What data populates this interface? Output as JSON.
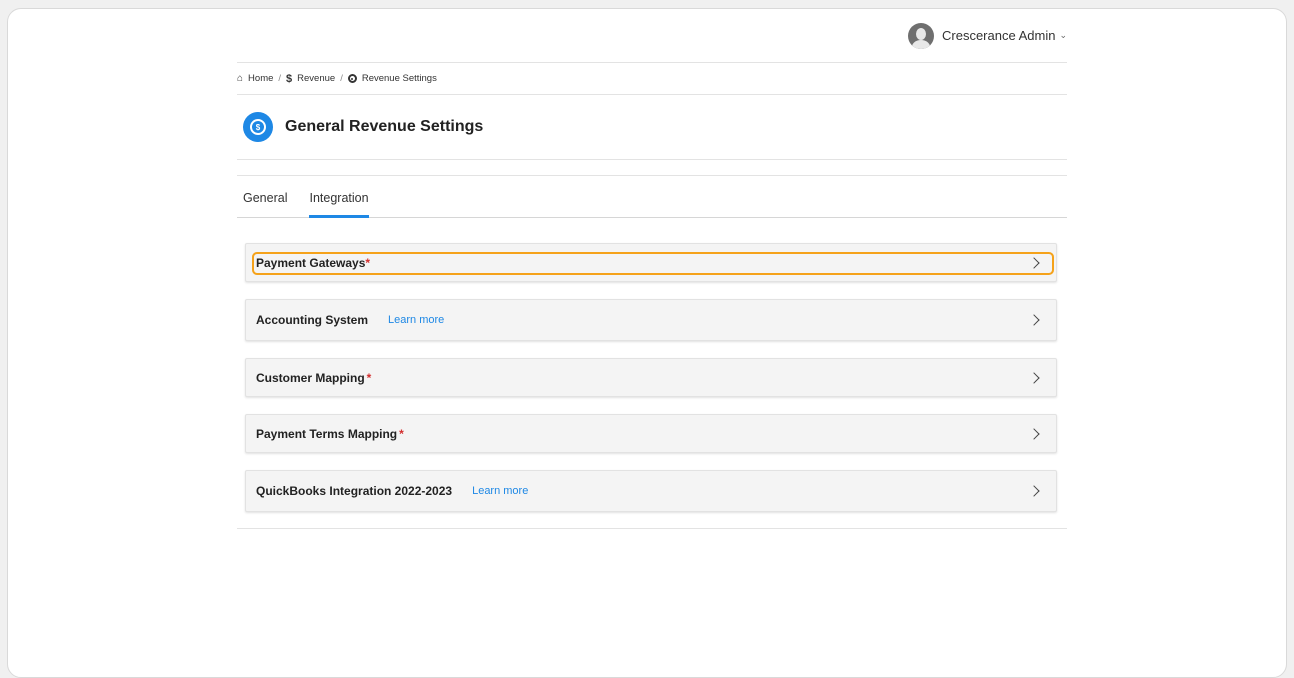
{
  "user": {
    "name": "Crescerance Admin",
    "caret": "⌄"
  },
  "breadcrumb": {
    "home": "Home",
    "sep": "/",
    "revenue": "Revenue",
    "settings": "Revenue Settings"
  },
  "page": {
    "title": "General Revenue Settings",
    "icon": "revenue-settings-icon"
  },
  "tabs": [
    {
      "label": "General",
      "active": false
    },
    {
      "label": "Integration",
      "active": true
    }
  ],
  "sections": [
    {
      "label": "Payment Gateways",
      "required_mark": "*",
      "link": ""
    },
    {
      "label": "Accounting System",
      "required_mark": "",
      "link": "Learn more"
    },
    {
      "label": "Customer Mapping",
      "required_mark": "*",
      "link": ""
    },
    {
      "label": "Payment Terms Mapping",
      "required_mark": "*",
      "link": ""
    },
    {
      "label": "QuickBooks Integration 2022-2023",
      "required_mark": "",
      "link": "Learn more"
    }
  ],
  "colors": {
    "accent": "#1e88e5",
    "required": "#d32f2f",
    "highlight": "#f5a21a"
  }
}
